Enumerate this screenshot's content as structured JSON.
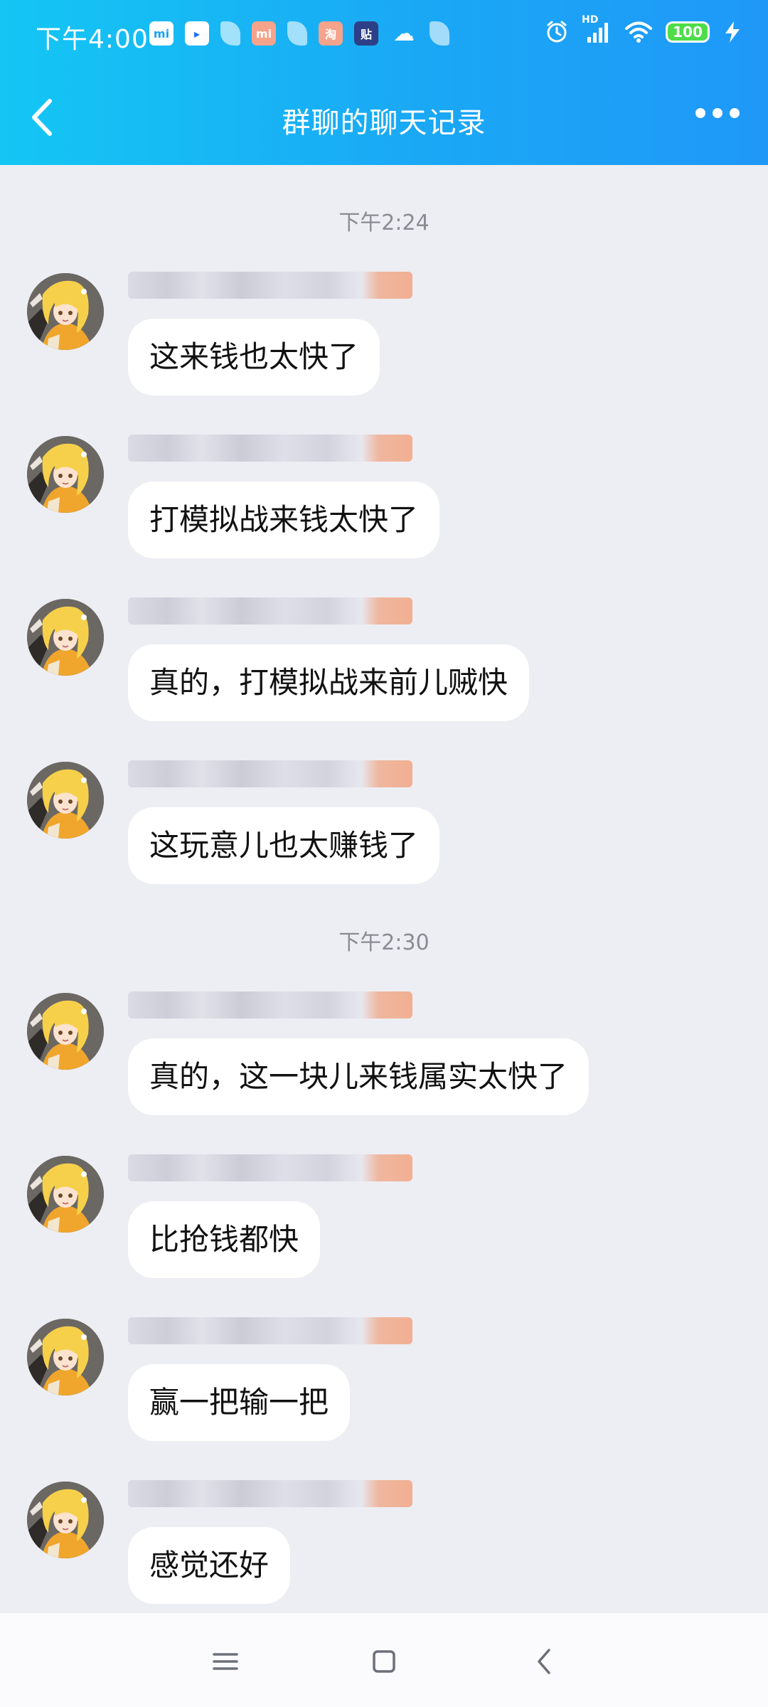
{
  "status_bar": {
    "time": "下午4:00",
    "notif_icons": [
      "mi",
      "▸",
      "",
      "mi",
      "",
      "淘",
      "贴",
      "☁",
      ""
    ],
    "battery": "100",
    "network_label": "HD"
  },
  "header": {
    "title": "群聊的聊天记录"
  },
  "chat": {
    "time_separators": [
      "下午2:24",
      "下午2:30"
    ],
    "messages": [
      {
        "text": "这来钱也太快了"
      },
      {
        "text": "打模拟战来钱太快了"
      },
      {
        "text": "真的，打模拟战来前儿贼快"
      },
      {
        "text": "这玩意儿也太赚钱了"
      },
      {
        "text": "真的，这一块儿来钱属实太快了"
      },
      {
        "text": "比抢钱都快"
      },
      {
        "text": "赢一把输一把"
      },
      {
        "text": "感觉还好"
      }
    ]
  },
  "colors": {
    "header_gradient_start": "#14c6f4",
    "header_gradient_end": "#1f98f8",
    "chat_background": "#edeef3",
    "bubble": "#ffffff",
    "timestamp_text": "#888c94",
    "avatar_hair": "#f6d04a",
    "avatar_jacket": "#f0a62c"
  },
  "icons": {
    "back": "chevron-left-icon",
    "more": "more-dots-icon",
    "nav_menu": "menu-icon",
    "nav_home": "home-square-icon",
    "nav_back": "back-chevron-icon"
  }
}
